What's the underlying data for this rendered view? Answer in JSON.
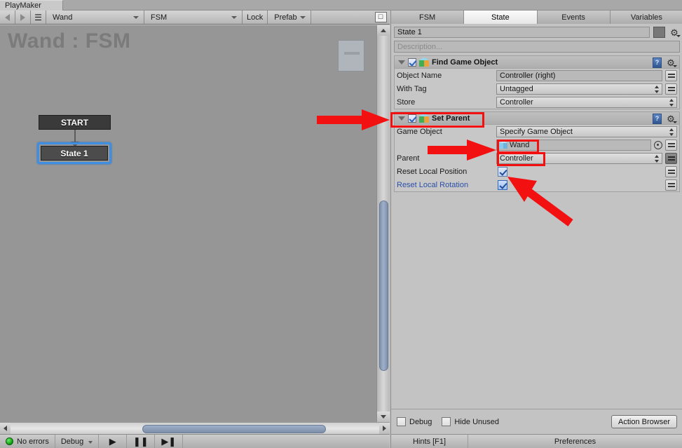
{
  "window": {
    "tab_label": "PlayMaker"
  },
  "toolbar": {
    "back_icon": "arrow-left-icon",
    "forward_icon": "arrow-right-icon",
    "menu_icon": "hamburger-menu-icon",
    "object_dropdown": "Wand",
    "fsm_dropdown": "FSM",
    "lock_label": "Lock",
    "prefab_label": "Prefab",
    "layout_icon": "window-layout-icon"
  },
  "canvas": {
    "title": "Wand : FSM",
    "minimap_icon": "minimap",
    "nodes": [
      {
        "label": "START",
        "selected": false
      },
      {
        "label": "State 1",
        "selected": true
      }
    ]
  },
  "status_bar": {
    "errors_label": "No errors",
    "errors_led_color": "#11a211",
    "debug_label": "Debug",
    "play_icon": "play-icon",
    "pause_icon": "pause-icon",
    "step_icon": "step-forward-icon"
  },
  "inspector": {
    "tabs": [
      {
        "label": "FSM",
        "active": false
      },
      {
        "label": "State",
        "active": true
      },
      {
        "label": "Events",
        "active": false
      },
      {
        "label": "Variables",
        "active": false
      }
    ],
    "state_name": "State 1",
    "state_color_swatch": "#787878",
    "state_gear_icon": "gear-icon",
    "description_placeholder": "Description...",
    "actions": [
      {
        "title": "Find Game Object",
        "enabled": true,
        "expanded": true,
        "icon": "unity-prefab-cube-icon",
        "help_icon": "help-book-icon",
        "gear_icon": "gear-icon",
        "highlighted": false,
        "rows": [
          {
            "label": "Object Name",
            "type": "text",
            "value": "Controller (right)",
            "has_eq_button": true,
            "eq_dark": false
          },
          {
            "label": "With Tag",
            "type": "popup",
            "value": "Untagged",
            "has_eq_button": true,
            "eq_dark": false
          },
          {
            "label": "Store",
            "type": "popup",
            "value": "Controller",
            "has_eq_button": false,
            "eq_dark": false
          }
        ]
      },
      {
        "title": "Set Parent",
        "enabled": true,
        "expanded": true,
        "icon": "unity-prefab-cube-icon",
        "help_icon": "help-book-icon",
        "gear_icon": "gear-icon",
        "highlighted": true,
        "rows": [
          {
            "label": "Game Object",
            "type": "popup",
            "value": "Specify Game Object",
            "has_eq_button": false,
            "eq_dark": false
          },
          {
            "label": "",
            "type": "object",
            "value": "Wand",
            "has_eq_button": true,
            "eq_dark": false,
            "has_target_picker": true,
            "highlighted": true
          },
          {
            "label": "Parent",
            "type": "popup",
            "value": "Controller",
            "has_eq_button": true,
            "eq_dark": true,
            "highlighted": true
          },
          {
            "label": "Reset Local Position",
            "type": "checkbox",
            "value": true,
            "has_eq_button": true,
            "eq_dark": false
          },
          {
            "label": "Reset Local Rotation",
            "type": "checkbox",
            "value": true,
            "has_eq_button": true,
            "eq_dark": false,
            "label_is_link": true
          }
        ]
      }
    ],
    "footer": {
      "debug_label": "Debug",
      "hide_unused_label": "Hide Unused",
      "action_browser_label": "Action Browser"
    },
    "bottom_bar": {
      "hints_label": "Hints [F1]",
      "preferences_label": "Preferences"
    }
  },
  "annotations": {
    "color": "#f21010",
    "arrows": [
      {
        "name": "arrow-to-set-parent-header"
      },
      {
        "name": "arrow-to-wand-object-field"
      },
      {
        "name": "arrow-to-reset-local-rotation-checkbox"
      }
    ],
    "boxes": [
      {
        "name": "highlight-set-parent-header"
      },
      {
        "name": "highlight-wand-field"
      },
      {
        "name": "highlight-controller-parent-field"
      }
    ]
  }
}
